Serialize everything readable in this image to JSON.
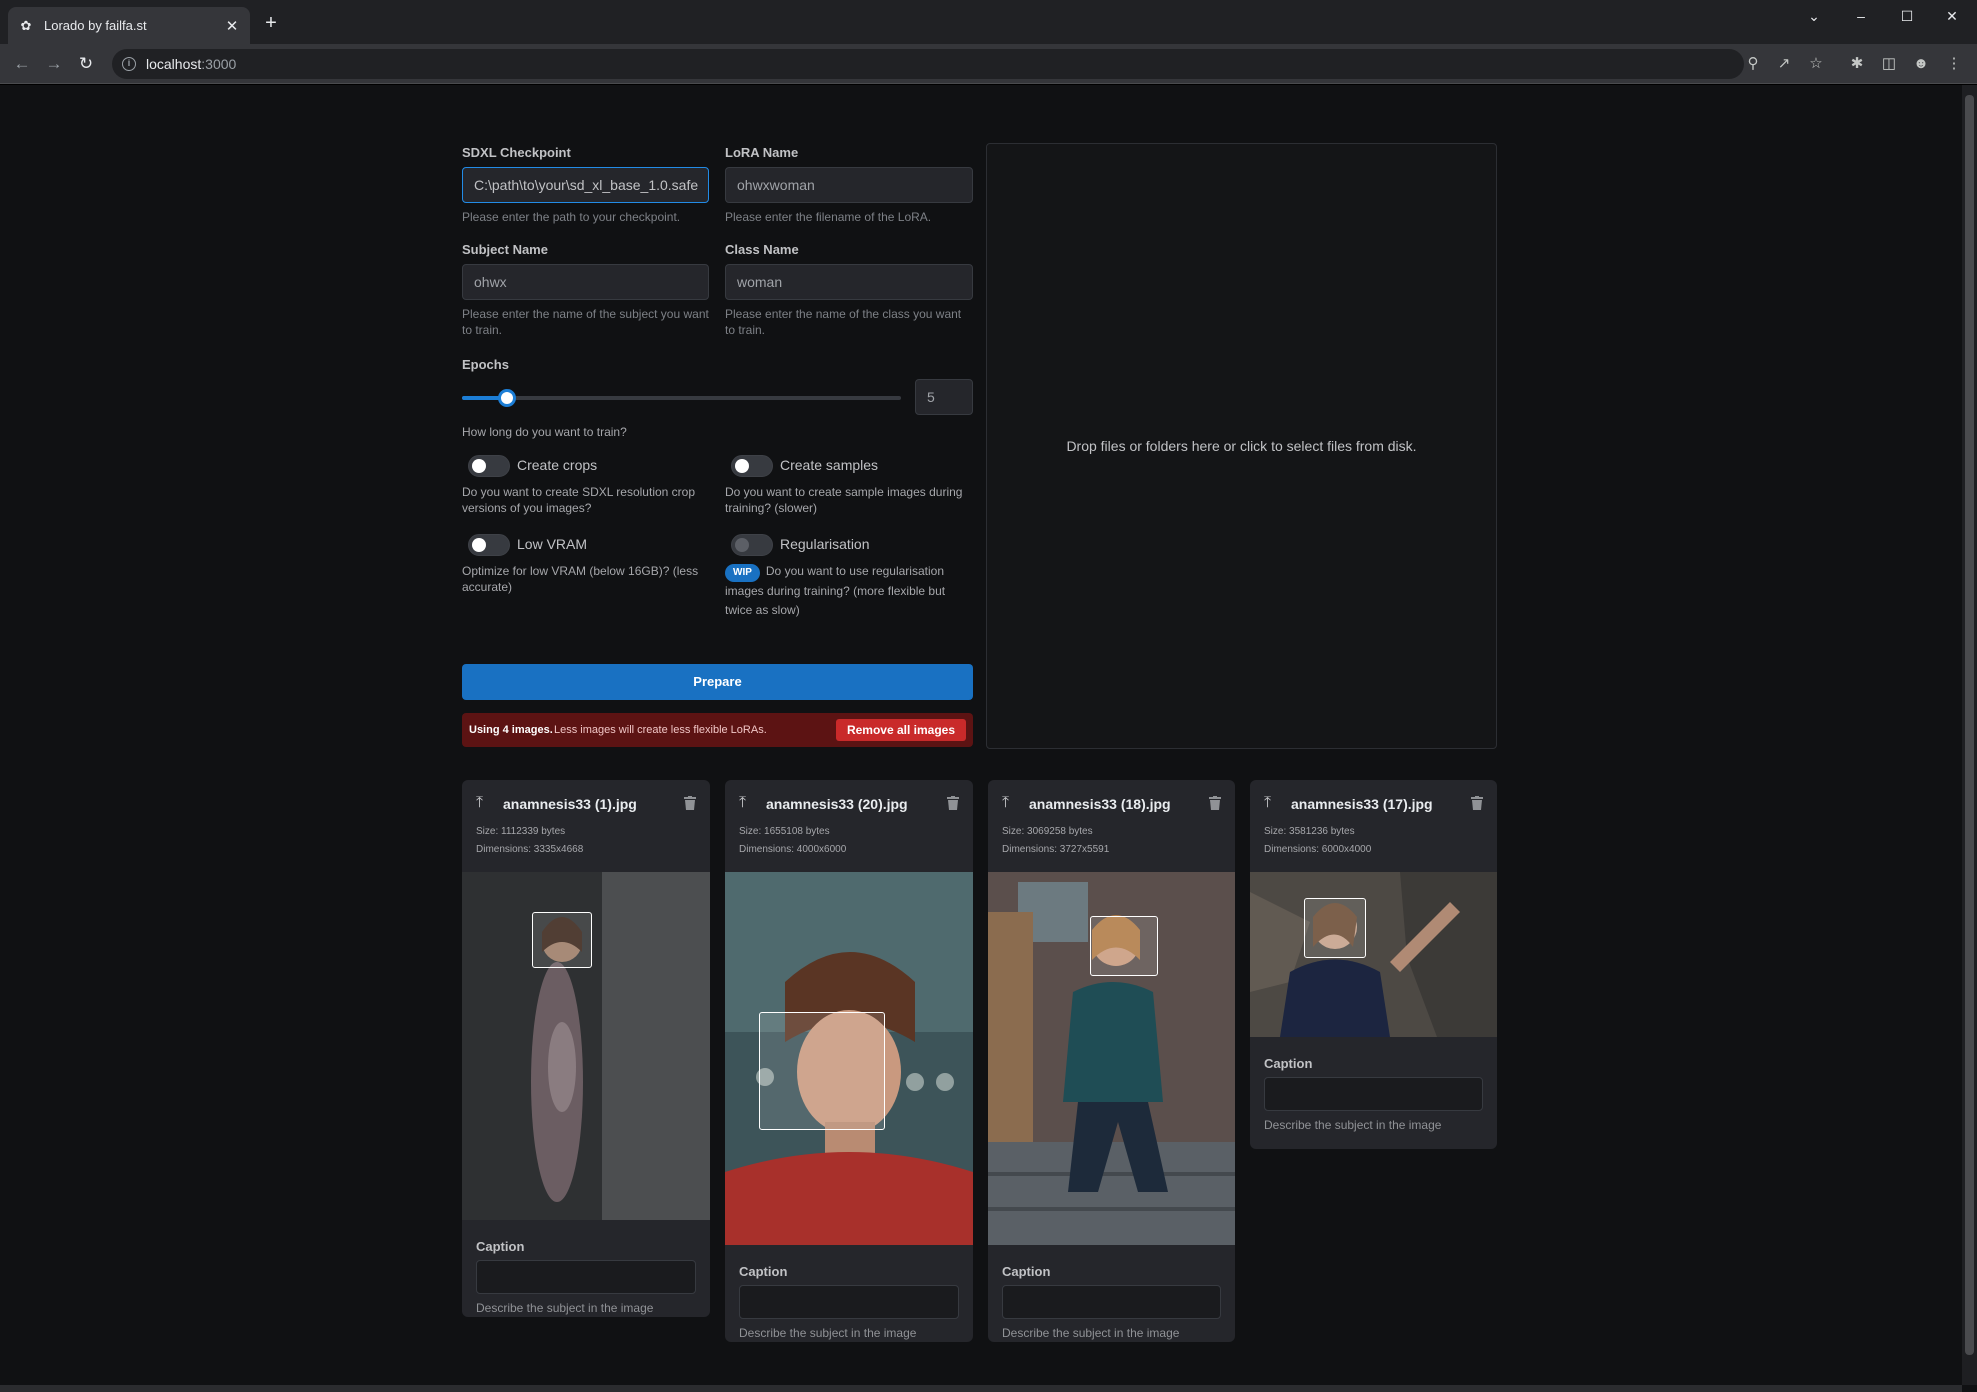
{
  "browser": {
    "tab_title": "Lorado by failfa.st",
    "url_host": "localhost",
    "url_port": ":3000"
  },
  "form": {
    "checkpoint": {
      "label": "SDXL Checkpoint",
      "value": "C:\\path\\to\\your\\sd_xl_base_1.0.safe",
      "description": "Please enter the path to your checkpoint."
    },
    "lora": {
      "label": "LoRA Name",
      "value": "ohwxwoman",
      "description": "Please enter the filename of the LoRA."
    },
    "subject": {
      "label": "Subject Name",
      "value": "ohwx",
      "description": "Please enter the name of the subject you want to train."
    },
    "class": {
      "label": "Class Name",
      "value": "woman",
      "description": "Please enter the name of the class you want to train."
    },
    "epochs": {
      "label": "Epochs",
      "value": "5",
      "min": 1,
      "max": 40,
      "description": "How long do you want to train?"
    },
    "toggles": {
      "crops": {
        "label": "Create crops",
        "on": false,
        "description": "Do you want to create SDXL resolution crop versions of you images?"
      },
      "samples": {
        "label": "Create samples",
        "on": false,
        "description": "Do you want to create sample images during training? (slower)"
      },
      "lowvram": {
        "label": "Low VRAM",
        "on": false,
        "description": "Optimize for low VRAM (below 16GB)? (less accurate)"
      },
      "regularisation": {
        "label": "Regularisation",
        "on": false,
        "badge": "WIP",
        "description": "Do you want to use regularisation images during training? (more flexible but twice as slow)"
      }
    },
    "prepare_label": "Prepare",
    "alert": {
      "count_text": "Using 4 images.",
      "hint": "Less images will create less flexible LoRAs.",
      "remove_label": "Remove all images"
    }
  },
  "dropzone": {
    "message": "Drop files or folders here or click to select files from disk."
  },
  "images": [
    {
      "name": "anamnesis33 (1).jpg",
      "size": "Size: 1112339 bytes",
      "dimensions": "Dimensions: 3335x4668",
      "caption_label": "Caption",
      "caption_hint": "Describe the subject in the image",
      "caption_value": ""
    },
    {
      "name": "anamnesis33 (20).jpg",
      "size": "Size: 1655108 bytes",
      "dimensions": "Dimensions: 4000x6000",
      "caption_label": "Caption",
      "caption_hint": "Describe the subject in the image",
      "caption_value": ""
    },
    {
      "name": "anamnesis33 (18).jpg",
      "size": "Size: 3069258 bytes",
      "dimensions": "Dimensions: 3727x5591",
      "caption_label": "Caption",
      "caption_hint": "Describe the subject in the image",
      "caption_value": ""
    },
    {
      "name": "anamnesis33 (17).jpg",
      "size": "Size: 3581236 bytes",
      "dimensions": "Dimensions: 6000x4000",
      "caption_label": "Caption",
      "caption_hint": "Describe the subject in the image",
      "caption_value": ""
    }
  ],
  "colors": {
    "primary": "#1971c2",
    "danger": "#c92a2a",
    "background": "#101113",
    "surface": "#25262b"
  }
}
